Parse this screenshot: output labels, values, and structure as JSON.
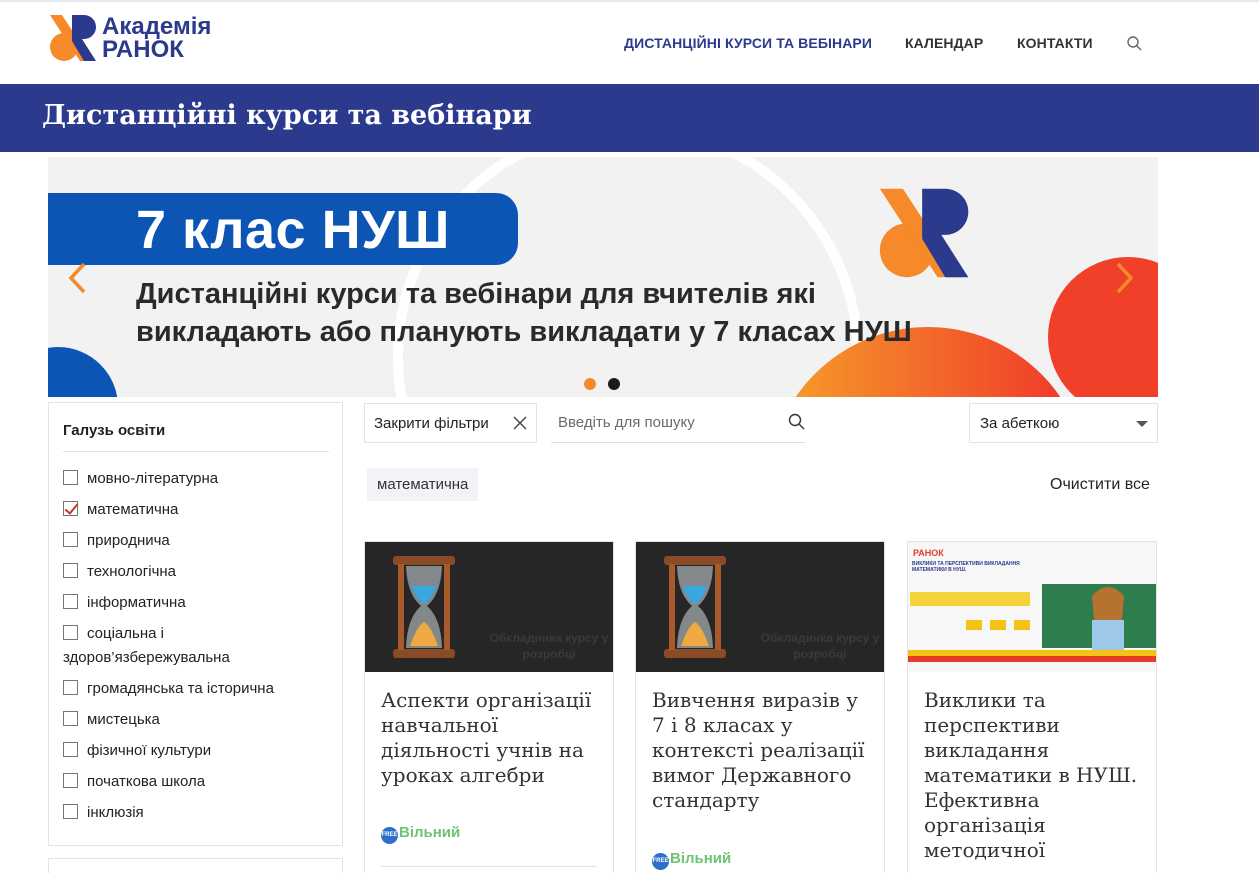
{
  "header": {
    "logo_line1": "Академія",
    "logo_line2": "РАНОК",
    "nav": [
      {
        "label": "ДИСТАНЦІЙНІ КУРСИ ТА ВЕБІНАРИ",
        "active": true
      },
      {
        "label": "КАЛЕНДАР",
        "active": false
      },
      {
        "label": "КОНТАКТИ",
        "active": false
      }
    ]
  },
  "page_title": "Дистанційні курси та вебінари",
  "slider": {
    "badge": "7 клас НУШ",
    "line1": "Дистанційні курси та вебінари для вчителів які",
    "line2": "викладають або планують викладати у 7 класах НУШ",
    "active_slide": 1,
    "slide_count": 2,
    "colors": {
      "blue": "#0d55b5",
      "orange": "#f6892a",
      "red": "#f0332a",
      "navy": "#2b3a8c"
    }
  },
  "sidebar": {
    "title": "Галузь освіти",
    "filters": [
      {
        "label": "мовно-літературна",
        "checked": false
      },
      {
        "label": "математична",
        "checked": true
      },
      {
        "label": "природнича",
        "checked": false
      },
      {
        "label": "технологічна",
        "checked": false
      },
      {
        "label": "інформатична",
        "checked": false
      },
      {
        "label": "соціальна і здоров’язбережувальна",
        "checked": false
      },
      {
        "label": "громадянська та історична",
        "checked": false
      },
      {
        "label": "мистецька",
        "checked": false
      },
      {
        "label": "фізичної культури",
        "checked": false
      },
      {
        "label": "початкова школа",
        "checked": false
      },
      {
        "label": "інклюзія",
        "checked": false
      }
    ]
  },
  "toolbar": {
    "close_filters": "Закрити фільтри",
    "search_placeholder": "Введіть для пошуку",
    "sort_value": "За абеткою",
    "active_chip": "математична",
    "clear_all": "Очистити все"
  },
  "cards": [
    {
      "title": "Аспекти організації навчальної діяльності учнів на уроках алгебри",
      "image_caption": "Обкладинка курсу у розробці",
      "free_badge": "FREE",
      "price_label": "Вільний"
    },
    {
      "title": "Вивчення виразів у 7 і 8 класах у контексті реалізації вимог Державного стандарту",
      "image_caption": "Обкладинка курсу у розробці",
      "free_badge": "FREE",
      "price_label": "Вільний"
    },
    {
      "title": "Виклики та перспективи викладання математики в НУШ. Ефективна організація методичної",
      "image_logo": "РАНОК",
      "image_heading": "ВИКЛИКИ ТА ПЕРСПЕКТИВИ ВИКЛАДАННЯ МАТЕМАТИКИ В НУШ."
    }
  ]
}
